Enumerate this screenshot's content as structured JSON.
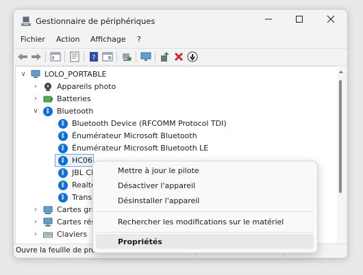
{
  "window": {
    "title": "Gestionnaire de périphériques"
  },
  "menu": [
    "Fichier",
    "Action",
    "Affichage",
    "?"
  ],
  "tree": {
    "root": "LOLO_PORTABLE",
    "nodes": [
      {
        "label": "Appareils photo",
        "icon": "camera-icon"
      },
      {
        "label": "Batteries",
        "icon": "battery-icon"
      },
      {
        "label": "Bluetooth",
        "icon": "bluetooth-icon",
        "expanded": true
      }
    ],
    "bluetooth_children": [
      "Bluetooth Device (RFCOMM Protocol TDI)",
      "Énumérateur Microsoft Bluetooth",
      "Énumérateur Microsoft Bluetooth LE",
      "HC06",
      "JBL Cl",
      "Realte",
      "Transp"
    ],
    "after": [
      {
        "label": "Cartes gra",
        "icon": "display-adapter-icon"
      },
      {
        "label": "Cartes rés",
        "icon": "network-adapter-icon"
      },
      {
        "label": "Claviers",
        "icon": "keyboard-icon"
      }
    ]
  },
  "context_menu": {
    "items": [
      "Mettre à jour le pilote",
      "Désactiver l'appareil",
      "Désinstaller l'appareil",
      "Rechercher les modifications sur le matériel",
      "Propriétés"
    ]
  },
  "status": {
    "text": "Ouvre la feuille de pro"
  }
}
